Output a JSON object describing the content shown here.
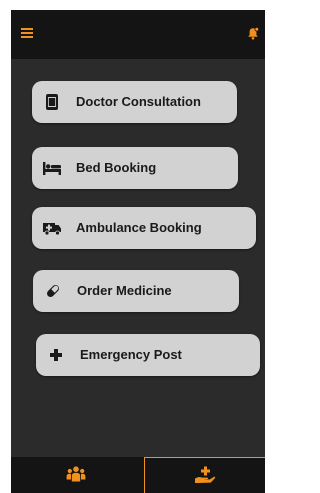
{
  "colors": {
    "accent": "#f0901e",
    "bar_background": "#141414",
    "app_background": "#2b2b2b",
    "button_background": "#d2d2d2",
    "button_text": "#1a1a1a"
  },
  "header": {
    "left_icon": "hamburger-menu-icon",
    "right_icon": "notification-bell-icon"
  },
  "menu": {
    "items": [
      {
        "label": "Doctor Consultation",
        "icon": "mobile-phone-icon"
      },
      {
        "label": "Bed Booking",
        "icon": "bed-icon"
      },
      {
        "label": "Ambulance Booking",
        "icon": "ambulance-icon"
      },
      {
        "label": "Order Medicine",
        "icon": "pill-capsule-icon"
      },
      {
        "label": "Emergency Post",
        "icon": "medical-cross-icon"
      }
    ]
  },
  "bottom_nav": {
    "tabs": [
      {
        "icon": "people-group-icon",
        "active": false
      },
      {
        "icon": "hand-holding-medical-icon",
        "active": true
      }
    ]
  }
}
